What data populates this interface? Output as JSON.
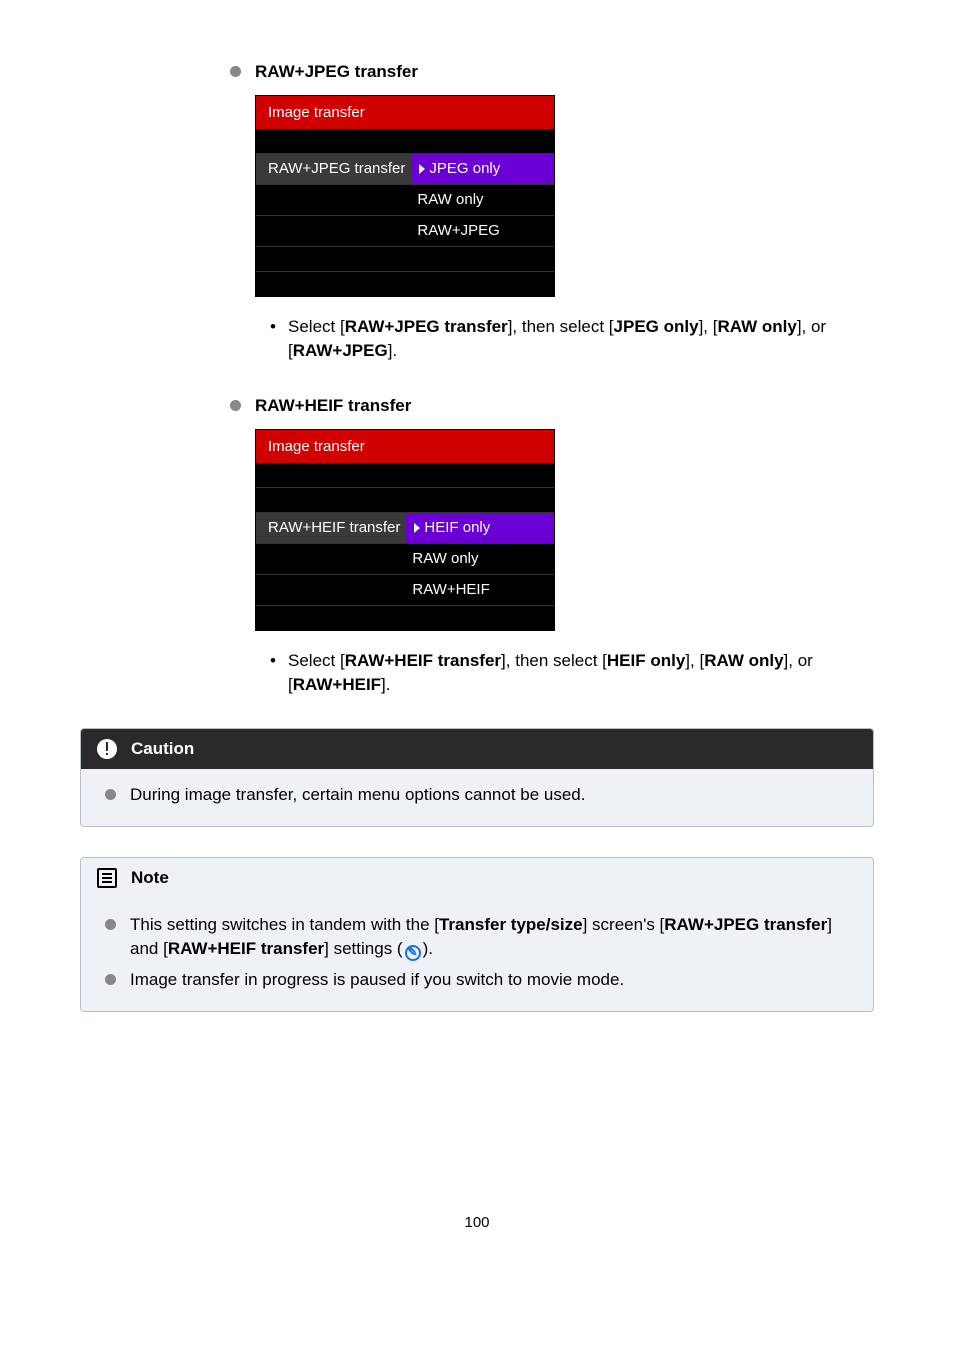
{
  "sections": {
    "jpeg": {
      "heading": "RAW+JPEG transfer",
      "cam": {
        "title": "Image transfer",
        "label": "RAW+JPEG transfer",
        "opts": [
          "JPEG only",
          "RAW only",
          "RAW+JPEG"
        ]
      },
      "instr_pre": "Select [",
      "instr_b1": "RAW+JPEG transfer",
      "instr_mid1": "], then select [",
      "instr_b2": "JPEG only",
      "instr_mid2": "], [",
      "instr_b3": "RAW only",
      "instr_mid3": "], or [",
      "instr_b4": "RAW+JPEG",
      "instr_end": "]."
    },
    "heif": {
      "heading": "RAW+HEIF transfer",
      "cam": {
        "title": "Image transfer",
        "label": "RAW+HEIF transfer",
        "opts": [
          "HEIF only",
          "RAW only",
          "RAW+HEIF"
        ]
      },
      "instr_pre": "Select [",
      "instr_b1": "RAW+HEIF transfer",
      "instr_mid1": "], then select [",
      "instr_b2": "HEIF only",
      "instr_mid2": "], [",
      "instr_b3": "RAW only",
      "instr_mid3": "], or [",
      "instr_b4": "RAW+HEIF",
      "instr_end": "]."
    }
  },
  "caution": {
    "title": "Caution",
    "text": "During image transfer, certain menu options cannot be used."
  },
  "note": {
    "title": "Note",
    "line1_a": "This setting switches in tandem with the [",
    "line1_b1": "Transfer type/size",
    "line1_b": "] screen's [",
    "line1_b2": "RAW+JPEG transfer",
    "line1_c": "] and [",
    "line1_b3": "RAW+HEIF transfer",
    "line1_d": "] settings (",
    "line1_e": ").",
    "line2": "Image transfer in progress is paused if you switch to movie mode."
  },
  "page": "100"
}
